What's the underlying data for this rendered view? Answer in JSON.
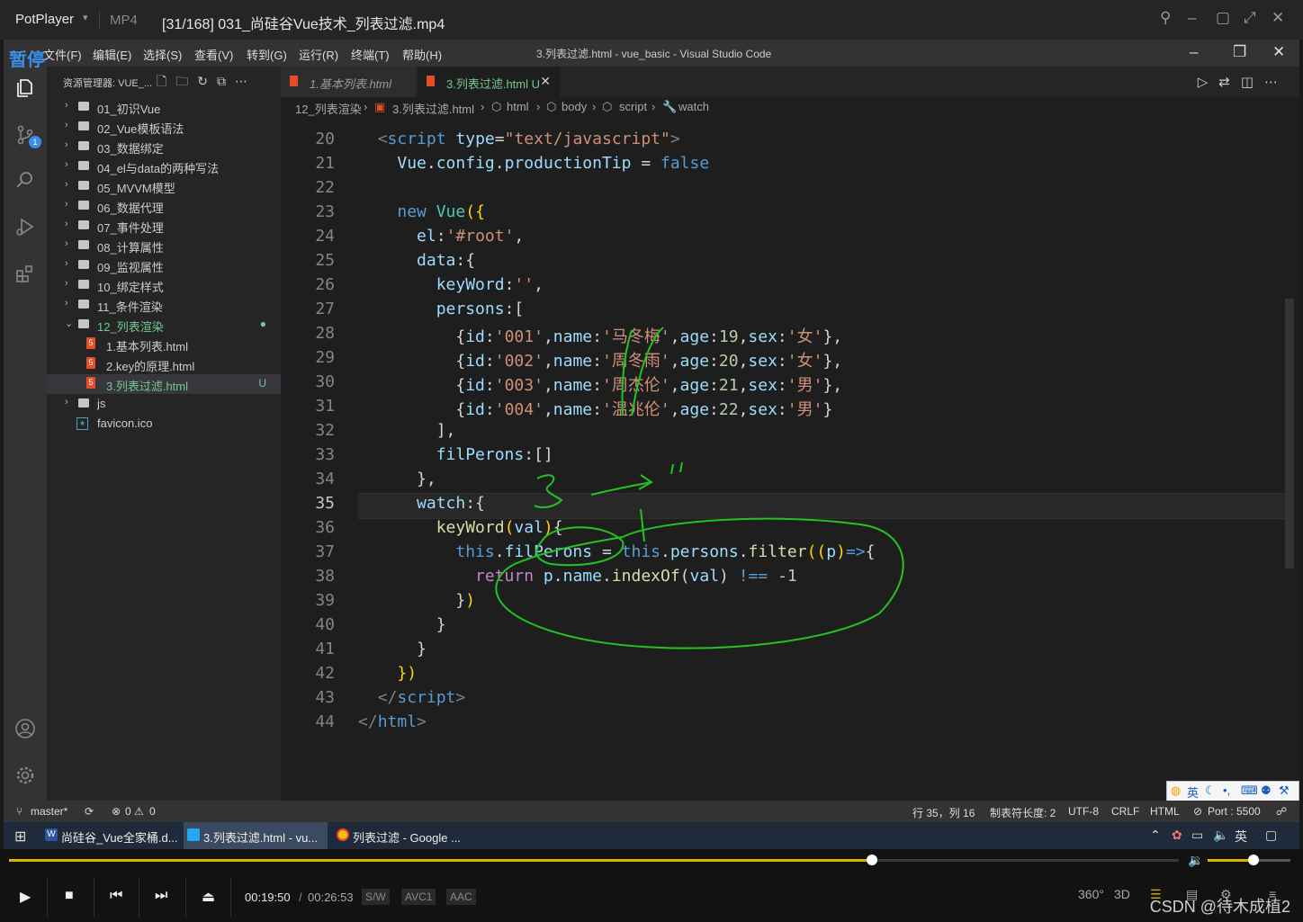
{
  "player": {
    "brand": "PotPlayer",
    "format": "MP4",
    "file_title": "[31/168] 031_尚硅谷Vue技术_列表过滤.mp4",
    "pause_label": "暂停",
    "time_current": "00:19:50",
    "time_separator": "/",
    "time_total": "00:26:53",
    "progress_fraction": 0.738,
    "volume_fraction": 0.55,
    "tags": [
      "S/W",
      "AVC1",
      "AAC"
    ],
    "right_buttons": [
      "360°",
      "3D"
    ],
    "watermark": "CSDN @待木成植2",
    "accent_color": "#d8b400"
  },
  "vscode": {
    "menu": [
      "文件(F)",
      "编辑(E)",
      "选择(S)",
      "查看(V)",
      "转到(G)",
      "运行(R)",
      "终端(T)",
      "帮助(H)"
    ],
    "window_title": "3.列表过滤.html - vue_basic - Visual Studio Code",
    "sidebar": {
      "header": "资源管理器: VUE_...",
      "items": [
        {
          "label": "01_初识Vue"
        },
        {
          "label": "02_Vue模板语法"
        },
        {
          "label": "03_数据绑定"
        },
        {
          "label": "04_el与data的两种写法"
        },
        {
          "label": "05_MVVM模型"
        },
        {
          "label": "06_数据代理"
        },
        {
          "label": "07_事件处理"
        },
        {
          "label": "08_计算属性"
        },
        {
          "label": "09_监视属性"
        },
        {
          "label": "10_绑定样式"
        },
        {
          "label": "11_条件渲染"
        },
        {
          "label": "12_列表渲染"
        },
        {
          "label": "1.基本列表.html"
        },
        {
          "label": "2.key的原理.html"
        },
        {
          "label": "3.列表过滤.html",
          "status": "U"
        },
        {
          "label": "js"
        },
        {
          "label": "favicon.ico"
        }
      ]
    },
    "tabs": [
      {
        "label": "1.基本列表.html"
      },
      {
        "label": "3.列表过滤.html",
        "status": "U"
      }
    ],
    "breadcrumb": [
      "12_列表渲染",
      "3.列表过滤.html",
      "html",
      "body",
      "script",
      "watch"
    ],
    "line_numbers": [
      "20",
      "21",
      "22",
      "23",
      "24",
      "25",
      "26",
      "27",
      "28",
      "29",
      "30",
      "31",
      "32",
      "33",
      "34",
      "35",
      "36",
      "37",
      "38",
      "39",
      "40",
      "41",
      "42",
      "43",
      "44"
    ],
    "status": {
      "branch": "master*",
      "problems": "0",
      "warnings": "0",
      "position": "行 35，列 16",
      "tab_size": "制表符长度: 2",
      "encoding": "UTF-8",
      "eol": "CRLF",
      "language": "HTML",
      "port": "Port : 5500"
    }
  },
  "taskbar": {
    "tasks": [
      {
        "label": "尚硅谷_Vue全家桶.d..."
      },
      {
        "label": "3.列表过滤.html - vu..."
      },
      {
        "label": "列表过滤 - Google ..."
      }
    ],
    "ime_label": "英"
  }
}
